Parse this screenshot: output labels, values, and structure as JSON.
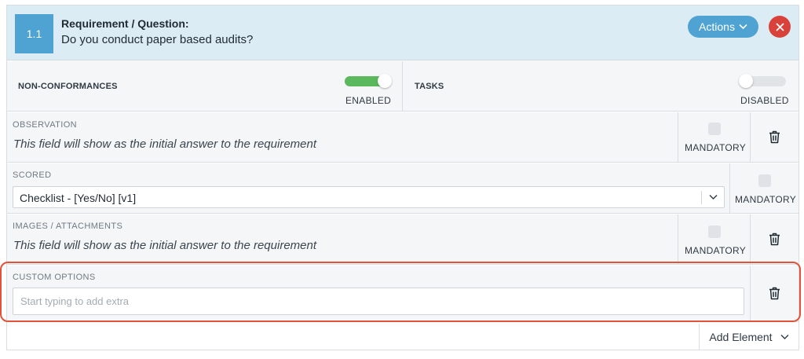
{
  "header": {
    "number": "1.1",
    "title": "Requirement / Question:",
    "question": "Do you conduct paper based audits?",
    "actions_label": "Actions",
    "close_icon": "close-icon"
  },
  "toggles": {
    "nonconformances": {
      "label": "NON-CONFORMANCES",
      "state": "ENABLED",
      "enabled": true
    },
    "tasks": {
      "label": "TASKS",
      "state": "DISABLED",
      "enabled": false
    }
  },
  "fields": {
    "observation": {
      "label": "OBSERVATION",
      "hint": "This field will show as the initial answer to the requirement",
      "mandatory_label": "MANDATORY"
    },
    "scored": {
      "label": "SCORED",
      "selected": "Checklist - [Yes/No] [v1]",
      "mandatory_label": "MANDATORY"
    },
    "images": {
      "label": "IMAGES / ATTACHMENTS",
      "hint": "This field will show as the initial answer to the requirement",
      "mandatory_label": "MANDATORY"
    },
    "custom": {
      "label": "CUSTOM OPTIONS",
      "placeholder": "Start typing to add extra"
    }
  },
  "footer": {
    "add_element_label": "Add Element"
  },
  "colors": {
    "accent": "#4ea3d3",
    "danger": "#d9423a",
    "success": "#5cb85c",
    "highlight": "#e0533a"
  }
}
